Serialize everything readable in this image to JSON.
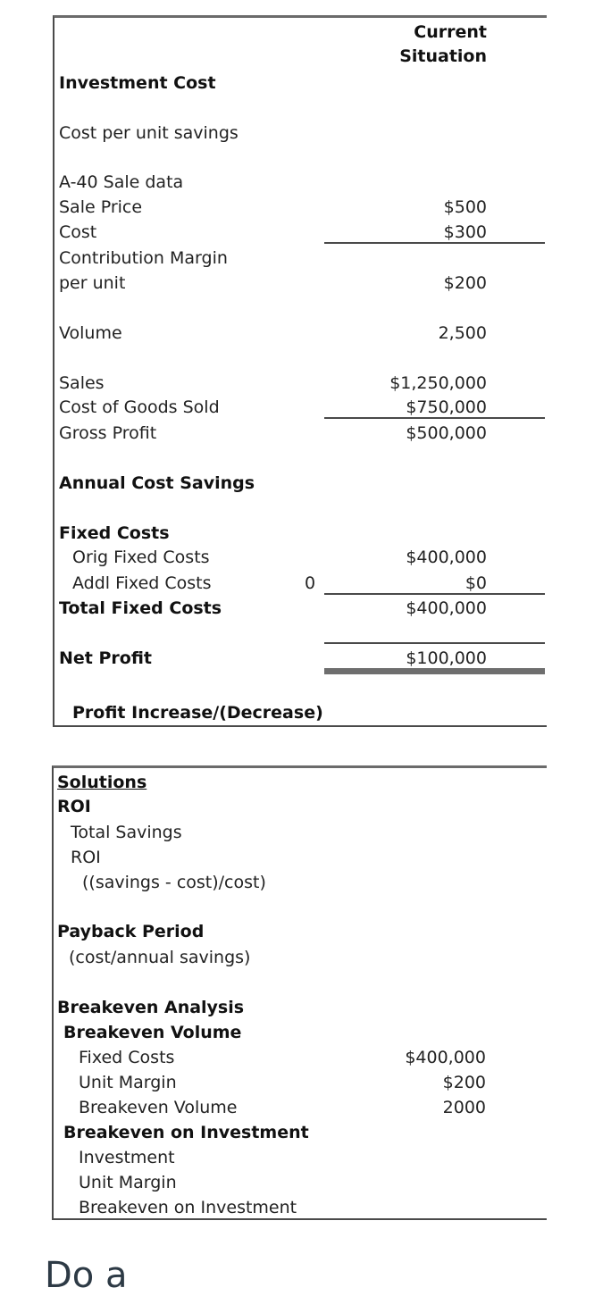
{
  "table1": {
    "column_header": [
      "Current",
      "Situation"
    ],
    "investment_cost_label": "Investment Cost",
    "cost_per_unit_savings_label": "Cost per unit savings",
    "sale_data_label": "A-40 Sale data",
    "sale_price": {
      "label": "Sale Price",
      "value": "$500"
    },
    "cost": {
      "label": "Cost",
      "value": "$300"
    },
    "contribution_margin": {
      "label_line1": "Contribution Margin",
      "label_line2": "per unit",
      "value": "$200"
    },
    "volume": {
      "label": "Volume",
      "value": "2,500"
    },
    "sales": {
      "label": "Sales",
      "value": "$1,250,000"
    },
    "cogs": {
      "label": "Cost of Goods Sold",
      "value": "$750,000"
    },
    "gross_profit": {
      "label": "Gross Profit",
      "value": "$500,000"
    },
    "annual_cost_savings_label": "Annual Cost Savings",
    "fixed_costs_label": "Fixed Costs",
    "orig_fixed_costs": {
      "label": "Orig Fixed Costs",
      "value": "$400,000"
    },
    "addl_fixed_costs": {
      "label": "Addl Fixed Costs",
      "input": "0",
      "value": "$0"
    },
    "total_fixed_costs": {
      "label": "Total Fixed Costs",
      "value": "$400,000"
    },
    "net_profit": {
      "label": "Net Profit",
      "value": "$100,000"
    },
    "profit_increase_label": "Profit Increase/(Decrease)"
  },
  "table2": {
    "solutions_label": "Solutions",
    "roi_heading": "ROI",
    "total_savings_label": "Total Savings",
    "roi_label": "ROI",
    "roi_formula": "((savings - cost)/cost)",
    "payback_heading": "Payback Period",
    "payback_formula": "(cost/annual savings)",
    "breakeven_heading": "Breakeven Analysis",
    "breakeven_volume_heading": "Breakeven Volume",
    "fixed_costs": {
      "label": "Fixed Costs",
      "value": "$400,000"
    },
    "unit_margin": {
      "label": "Unit Margin",
      "value": "$200"
    },
    "breakeven_volume": {
      "label": "Breakeven Volume",
      "value": "2000"
    },
    "breakeven_investment_heading": "Breakeven on Investment",
    "investment_label": "Investment",
    "unit_margin2_label": "Unit Margin",
    "breakeven_investment_label": "Breakeven on Investment"
  },
  "footer_heading_partial": "Do      a   "
}
